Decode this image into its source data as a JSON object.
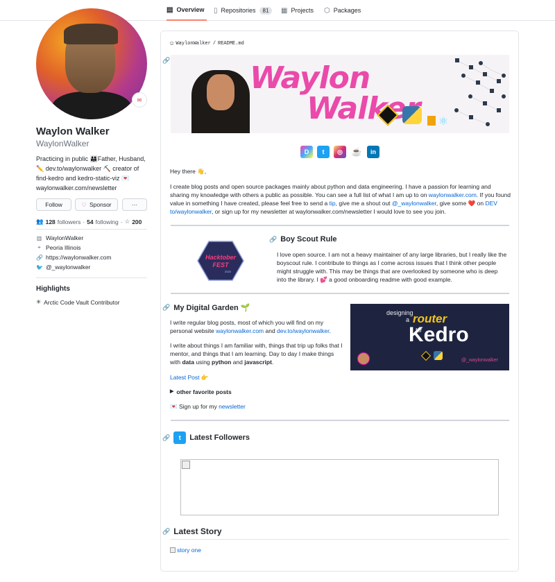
{
  "nav": {
    "tabs": [
      {
        "label": "Overview",
        "icon": "book-icon"
      },
      {
        "label": "Repositories",
        "icon": "repo-icon",
        "count": "81"
      },
      {
        "label": "Projects",
        "icon": "project-icon"
      },
      {
        "label": "Packages",
        "icon": "package-icon"
      }
    ]
  },
  "profile": {
    "name": "Waylon Walker",
    "login": "WaylonWalker",
    "bio": "Practicing in public 👨‍👩‍👧Father, Husband, ✏️ dev.to/waylonwalker ⛏️ creator of find-kedro and kedro-static-viz 💌 waylonwalker.com/newsletter",
    "follow_label": "Follow",
    "sponsor_label": "Sponsor",
    "more_label": "···",
    "followers_count": "128",
    "followers_label": "followers",
    "following_count": "54",
    "following_label": "following",
    "dot": "·",
    "stars_count": "200",
    "company": "WaylonWalker",
    "location": "Peoria Illinois",
    "website": "https://waylonwalker.com",
    "twitter": "@_waylonwalker",
    "highlights_title": "Highlights",
    "highlight_item": "Arctic Code Vault Contributor"
  },
  "readme": {
    "crumb_user": "WaylonWalker",
    "crumb_sep": "/",
    "crumb_file": "README.md",
    "banner_name_1": "Waylon",
    "banner_name_2": "Walker",
    "greeting": "Hey there 👋,",
    "intro_1": "I create blog posts and open source packages mainly about python and data engineering. I have a passion for learning and sharing my knowledge with others a public as possible. You can see a full list of what I am up to on ",
    "intro_link_site": "waylonwalker.com",
    "intro_2": ". If you found value in something I have created, please feel free to send a ",
    "intro_link_tip": "tip",
    "intro_3": ", give me a shout out ",
    "intro_link_twitter": "@_waylonwalker",
    "intro_4": ", give some ❤️ on ",
    "intro_link_dev": "DEV to/waylonwalker",
    "intro_5": ", or sign up for my newsletter at waylonwalker.com/newsletter I would love to see you join.",
    "boy_scout_title": "Boy Scout Rule",
    "boy_scout_text": "I love open source. I am not a heavy maintainer of any large libraries, but I really like the boyscout rule. I contribute to things as I come across issues that I think other people might struggle with. This may be things that are overlooked by someone who is deep into the library. I 💕 a good onboarding readme with good example.",
    "hacktober_1": "Hacktober",
    "hacktober_2": "FEST",
    "hacktober_3": "2020",
    "garden_title": "My Digital Garden 🌱",
    "garden_p1_a": "I write regular blog posts, most of which you will find on my personal website ",
    "garden_p1_link1": "waylonwalker.com",
    "garden_p1_b": " and ",
    "garden_p1_link2": "dev.to/waylonwalker",
    "garden_p1_c": ".",
    "garden_p2_a": "I write about things I am familiar with, things that trip up folks that I mentor, and things that I am learning. Day to day I make things with ",
    "garden_p2_b1": "data",
    "garden_p2_b": " using ",
    "garden_p2_b2": "python",
    "garden_p2_c": " and ",
    "garden_p2_b3": "javascript",
    "garden_p2_d": ".",
    "latest_post": "Latest Post 👉",
    "other_posts": "other favorite posts",
    "newsletter_a": "💌 Sign up for my ",
    "newsletter_link": "newsletter",
    "kedro_card_1": "designing",
    "kedro_card_2": "a",
    "kedro_card_3": "router",
    "kedro_card_4": "for",
    "kedro_card_5": "Kedro",
    "kedro_card_handle": "@_waylonwalker",
    "followers_title": "Latest Followers",
    "story_title": "Latest Story",
    "story_alt": "story one"
  },
  "colors": {
    "accent_tab": "#f9826c",
    "link": "#0366d6",
    "banner_pink": "#ea4aaa"
  }
}
